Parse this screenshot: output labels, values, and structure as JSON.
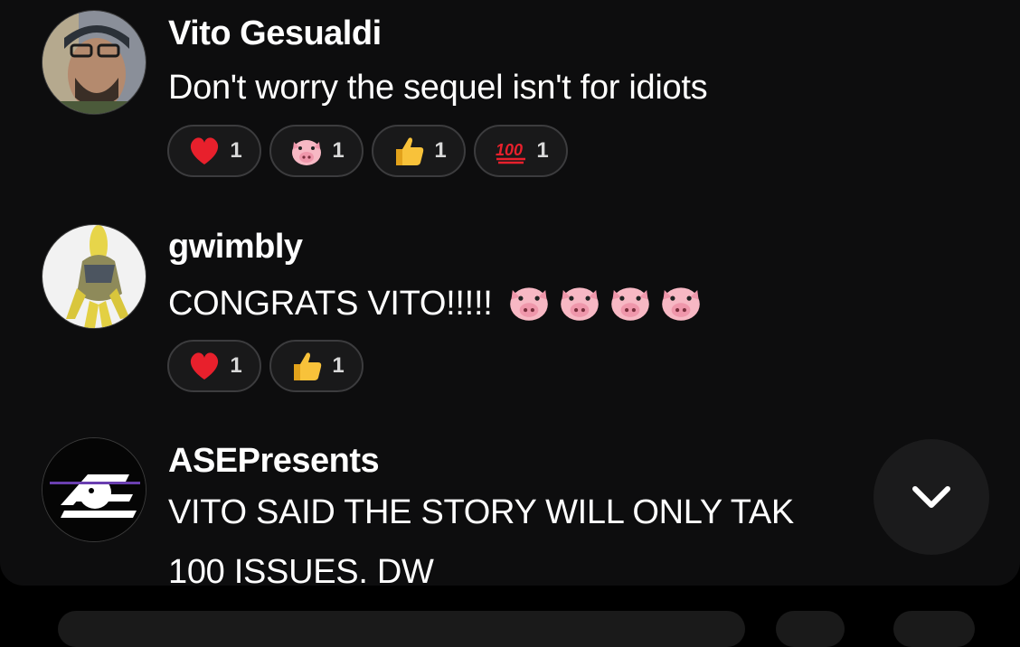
{
  "comments": [
    {
      "author": "Vito Gesualdi",
      "text": "Don't worry the sequel isn't for idiots",
      "reactions": [
        {
          "emoji": "heart",
          "count": "1"
        },
        {
          "emoji": "pig",
          "count": "1"
        },
        {
          "emoji": "thumbs-up",
          "count": "1"
        },
        {
          "emoji": "hundred",
          "count": "1"
        }
      ]
    },
    {
      "author": "gwimbly",
      "text": "CONGRATS VITO!!!!!",
      "inline_emoji": [
        "pig",
        "pig",
        "pig",
        "pig"
      ],
      "reactions": [
        {
          "emoji": "heart",
          "count": "1"
        },
        {
          "emoji": "thumbs-up",
          "count": "1"
        }
      ]
    },
    {
      "author": "ASEPresents",
      "text_line1": "VITO SAID THE STORY WILL ONLY TAK",
      "text_line2": "100 ISSUES. DW"
    }
  ],
  "scroll_button": {
    "icon": "chevron-down-icon"
  },
  "colors": {
    "background": "#0d0d0e",
    "pill": "#19191a",
    "pill_border": "#3c3c3e",
    "text": "#ffffff"
  }
}
